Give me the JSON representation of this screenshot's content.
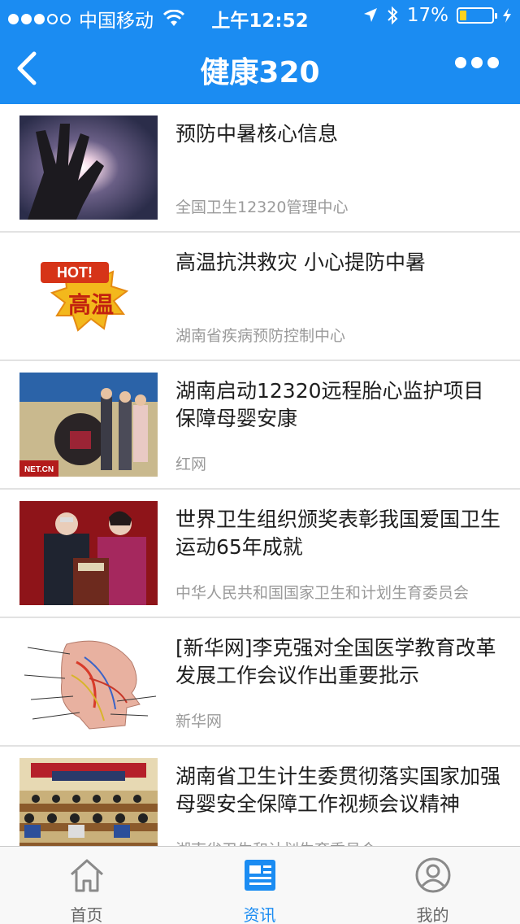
{
  "status": {
    "carrier": "中国移动",
    "time": "上午12:52",
    "battery": "17%"
  },
  "nav": {
    "title": "健康320"
  },
  "articles": [
    {
      "title": "预防中暑核心信息",
      "source": "全国卫生12320管理中心"
    },
    {
      "title": "高温抗洪救灾 小心提防中暑",
      "source": "湖南省疾病预防控制中心",
      "thumb_badge": "HOT!",
      "thumb_text": "高温"
    },
    {
      "title": "湖南启动12320远程胎心监护项目保障母婴安康",
      "source": "红网",
      "thumb_caption": "NET.CN"
    },
    {
      "title": "世界卫生组织颁奖表彰我国爱国卫生运动65年成就",
      "source": "中华人民共和国国家卫生和计划生育委员会"
    },
    {
      "title": "[新华网]李克强对全国医学教育改革发展工作会议作出重要批示",
      "source": "新华网"
    },
    {
      "title": "湖南省卫生计生委贯彻落实国家加强母婴安全保障工作视频会议精神",
      "source": "湖南省卫生和计划生育委员会"
    }
  ],
  "tabs": [
    {
      "label": "首页",
      "icon": "home-icon"
    },
    {
      "label": "资讯",
      "icon": "news-icon"
    },
    {
      "label": "我的",
      "icon": "profile-icon"
    }
  ],
  "colors": {
    "accent": "#1b8cf2",
    "battery": "#ffd21f"
  }
}
